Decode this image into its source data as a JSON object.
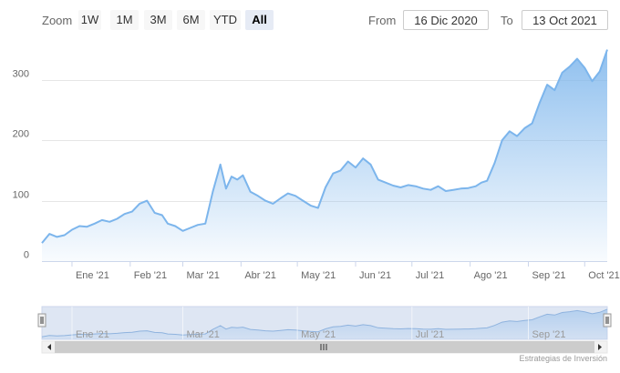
{
  "range_selector": {
    "zoom_label": "Zoom",
    "buttons": [
      "1W",
      "1M",
      "3M",
      "6M",
      "YTD",
      "All"
    ],
    "active": "All",
    "from_label": "From",
    "from_value": "16 Dic 2020",
    "to_label": "To",
    "to_value": "13 Oct 2021"
  },
  "navigator": {
    "labels": [
      "Ene '21",
      "Mar '21",
      "May '21",
      "Jul '21",
      "Sep '21"
    ]
  },
  "credits": "Estrategias de Inversión",
  "colors": {
    "line": "#7cb5ec",
    "fill_top": "#7cb5ec",
    "grid": "#e6e6e6",
    "navigator_mask": "#ccd6eb"
  },
  "chart_data": {
    "type": "area",
    "title": "",
    "xlabel": "",
    "ylabel": "",
    "ylim": [
      0,
      360
    ],
    "yticks": [
      0,
      100,
      200,
      300
    ],
    "xticks": [
      {
        "date": "2021-01-01",
        "label": "Ene '21"
      },
      {
        "date": "2021-02-01",
        "label": "Feb '21"
      },
      {
        "date": "2021-03-01",
        "label": "Mar '21"
      },
      {
        "date": "2021-04-01",
        "label": "Abr '21"
      },
      {
        "date": "2021-05-01",
        "label": "May '21"
      },
      {
        "date": "2021-06-01",
        "label": "Jun '21"
      },
      {
        "date": "2021-07-01",
        "label": "Jul '21"
      },
      {
        "date": "2021-08-01",
        "label": "Ago '21"
      },
      {
        "date": "2021-09-01",
        "label": "Sep '21"
      },
      {
        "date": "2021-10-01",
        "label": "Oct '21"
      }
    ],
    "grid": true,
    "series": [
      {
        "x": [
          "2020-12-16",
          "2020-12-20",
          "2020-12-24",
          "2020-12-28",
          "2021-01-01",
          "2021-01-05",
          "2021-01-09",
          "2021-01-13",
          "2021-01-17",
          "2021-01-21",
          "2021-01-25",
          "2021-01-29",
          "2021-02-02",
          "2021-02-06",
          "2021-02-10",
          "2021-02-14",
          "2021-02-18",
          "2021-02-21",
          "2021-02-25",
          "2021-03-01",
          "2021-03-05",
          "2021-03-09",
          "2021-03-13",
          "2021-03-17",
          "2021-03-21",
          "2021-03-24",
          "2021-03-27",
          "2021-03-30",
          "2021-04-02",
          "2021-04-06",
          "2021-04-10",
          "2021-04-14",
          "2021-04-18",
          "2021-04-22",
          "2021-04-26",
          "2021-04-30",
          "2021-05-04",
          "2021-05-08",
          "2021-05-12",
          "2021-05-16",
          "2021-05-20",
          "2021-05-24",
          "2021-05-28",
          "2021-06-01",
          "2021-06-05",
          "2021-06-09",
          "2021-06-13",
          "2021-06-17",
          "2021-06-21",
          "2021-06-25",
          "2021-06-29",
          "2021-07-03",
          "2021-07-07",
          "2021-07-11",
          "2021-07-15",
          "2021-07-19",
          "2021-07-23",
          "2021-07-27",
          "2021-07-31",
          "2021-08-04",
          "2021-08-07",
          "2021-08-10",
          "2021-08-14",
          "2021-08-18",
          "2021-08-22",
          "2021-08-26",
          "2021-08-30",
          "2021-09-03",
          "2021-09-07",
          "2021-09-11",
          "2021-09-15",
          "2021-09-19",
          "2021-09-23",
          "2021-09-27",
          "2021-10-01",
          "2021-10-05",
          "2021-10-09",
          "2021-10-13"
        ],
        "y": [
          30,
          45,
          40,
          43,
          52,
          58,
          57,
          62,
          68,
          65,
          70,
          78,
          82,
          95,
          100,
          80,
          76,
          62,
          58,
          50,
          55,
          60,
          62,
          115,
          160,
          120,
          140,
          135,
          142,
          115,
          108,
          100,
          95,
          104,
          112,
          108,
          100,
          92,
          88,
          122,
          145,
          150,
          165,
          155,
          170,
          160,
          135,
          130,
          125,
          122,
          126,
          124,
          120,
          118,
          124,
          116,
          118,
          120,
          121,
          124,
          130,
          133,
          162,
          200,
          215,
          207,
          220,
          228,
          262,
          292,
          283,
          312,
          322,
          335,
          320,
          298,
          314,
          350
        ]
      }
    ]
  }
}
